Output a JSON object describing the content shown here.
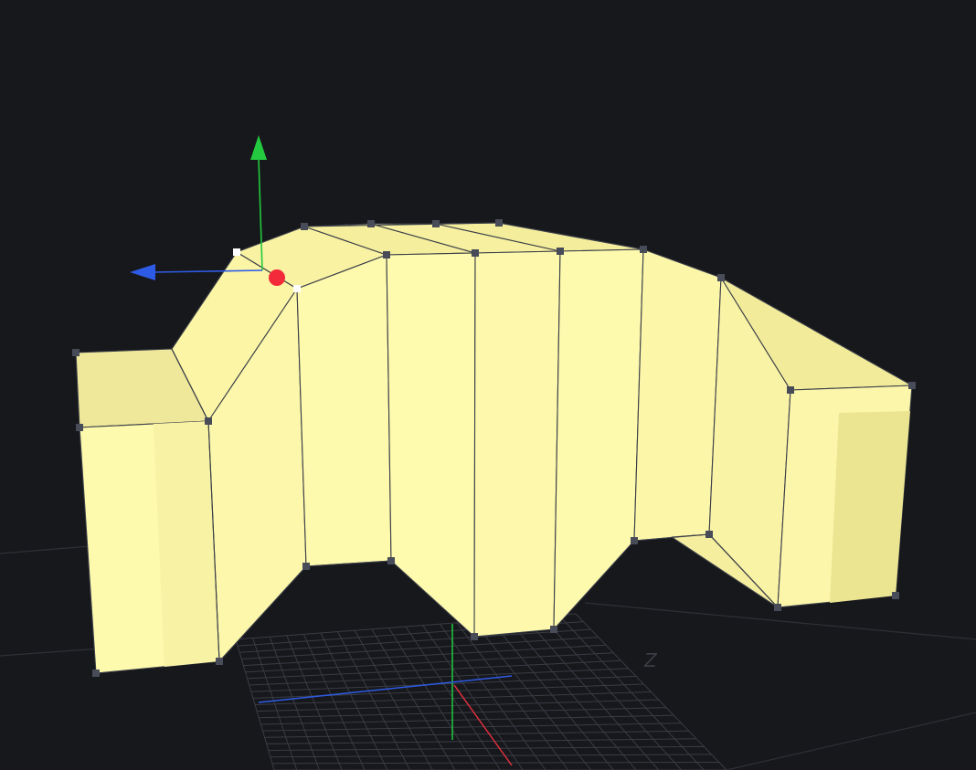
{
  "viewport": {
    "background": "#17181c",
    "axis_label": "Z"
  },
  "colors": {
    "mesh_face": "#fdf9ad",
    "mesh_face_shade": "#ece68f",
    "mesh_face_top": "#f3ec9c",
    "edge": "#3b3e48",
    "vertex": "#474c58",
    "vertex_selected": "#ffffff",
    "grid": "#3a3c44",
    "axis_x": "#e0303f",
    "axis_y": "#23c93e",
    "axis_z": "#2e5be6",
    "pivot": "#f22a3a"
  },
  "gizmo": {
    "icons": [
      "translate-y-arrow-icon",
      "translate-z-arrow-icon",
      "pivot-handle-icon"
    ]
  }
}
